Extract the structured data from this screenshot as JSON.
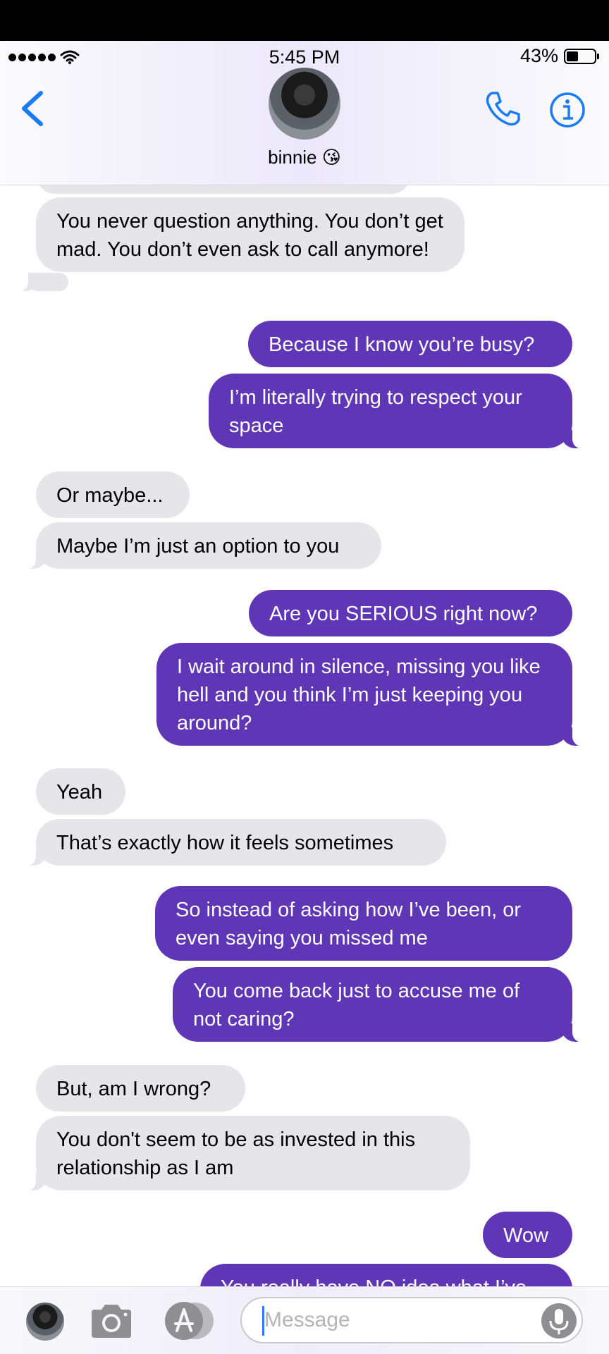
{
  "status_bar": {
    "time": "5:45 PM",
    "battery_text": "43%",
    "battery_level": 0.43
  },
  "header": {
    "contact_name": "binnie 😘",
    "icons": [
      "back-chevron-icon",
      "contact-avatar",
      "phone-icon",
      "info-icon"
    ],
    "accent_color": "#1a7cf5"
  },
  "messages": [
    {
      "from": "them",
      "text": "You never question anything. You don’t get mad. You don’t even ask to call anymore!"
    },
    {
      "from": "me",
      "text": "Because I know you’re busy?"
    },
    {
      "from": "me",
      "text": "I’m literally trying to respect your space"
    },
    {
      "from": "them",
      "text": "Or maybe..."
    },
    {
      "from": "them",
      "text": "Maybe I’m just an option to you"
    },
    {
      "from": "me",
      "text": "Are you SERIOUS right now?"
    },
    {
      "from": "me",
      "text": "I wait around in silence, missing you like hell and you think I’m just keeping you around?"
    },
    {
      "from": "them",
      "text": "Yeah"
    },
    {
      "from": "them",
      "text": "That’s exactly how it feels sometimes"
    },
    {
      "from": "me",
      "text": "So instead of asking how I’ve been, or even saying you missed me"
    },
    {
      "from": "me",
      "text": "You come back just to accuse me of not caring?"
    },
    {
      "from": "them",
      "text": "But, am I wrong?"
    },
    {
      "from": "them",
      "text": "You don't seem to be as invested in this relationship as I am"
    },
    {
      "from": "me",
      "text": "Wow"
    },
    {
      "from": "me",
      "text": "You really have NO idea what I’ve"
    }
  ],
  "colors": {
    "incoming_bubble": "#e5e5ea",
    "outgoing_bubble": "#5f36b6"
  },
  "composer": {
    "placeholder": "Message",
    "value": "",
    "icons": [
      "camera-icon",
      "app-store-icon",
      "microphone-icon"
    ]
  }
}
